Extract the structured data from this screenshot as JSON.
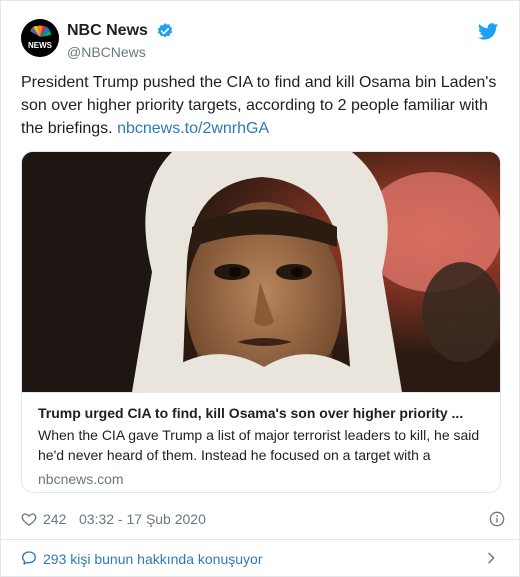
{
  "account": {
    "display_name": "NBC News",
    "handle": "@NBCNews",
    "avatar_text": "NEWS",
    "verified": true
  },
  "tweet": {
    "text": "President Trump pushed the CIA to find and kill Osama bin Laden's son over higher priority targets, according to 2 people familiar with the briefings. ",
    "link_text": "nbcnews.to/2wnrhGA"
  },
  "card": {
    "title": "Trump urged CIA to find, kill Osama's son over higher priority ...",
    "description": "When the CIA gave Trump a list of major terrorist leaders to kill, he said he'd never heard of them. Instead he focused on a target with a",
    "domain": "nbcnews.com"
  },
  "meta": {
    "like_count": "242",
    "timestamp": "03:32 - 17 Şub 2020"
  },
  "conversation": {
    "label": "293 kişi bunun hakkında konuşuyor"
  },
  "colors": {
    "link": "#2b7bb9",
    "twitter_blue": "#1da1f2",
    "muted": "#697882",
    "border": "#e1e8ed"
  },
  "icons": {
    "verified": "verified-badge-icon",
    "brand": "twitter-bird-icon",
    "like": "heart-icon",
    "info": "info-icon",
    "reply": "speech-bubble-icon",
    "more": "chevron-right-icon"
  }
}
